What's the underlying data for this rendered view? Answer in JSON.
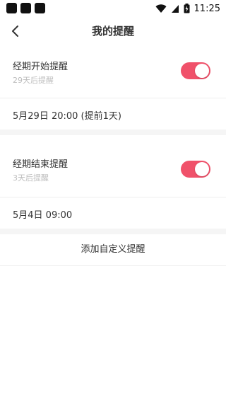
{
  "status_bar": {
    "time": "11:25",
    "icons": [
      "notification-icon",
      "notification-icon",
      "notification-icon",
      "wifi-icon",
      "signal-icon",
      "battery-charging-icon"
    ]
  },
  "header": {
    "title": "我的提醒",
    "back_icon": "chevron-left-icon"
  },
  "reminders": [
    {
      "title": "经期开始提醒",
      "subtitle": "29天后提醒",
      "enabled": true,
      "time": "5月29日 20:00 (提前1天)"
    },
    {
      "title": "经期结束提醒",
      "subtitle": "3天后提醒",
      "enabled": true,
      "time": "5月4日 09:00"
    }
  ],
  "actions": {
    "add_label": "添加自定义提醒"
  },
  "colors": {
    "accent": "#f0516a",
    "divider": "#eeeeee",
    "section_gap": "#f5f5f5"
  }
}
